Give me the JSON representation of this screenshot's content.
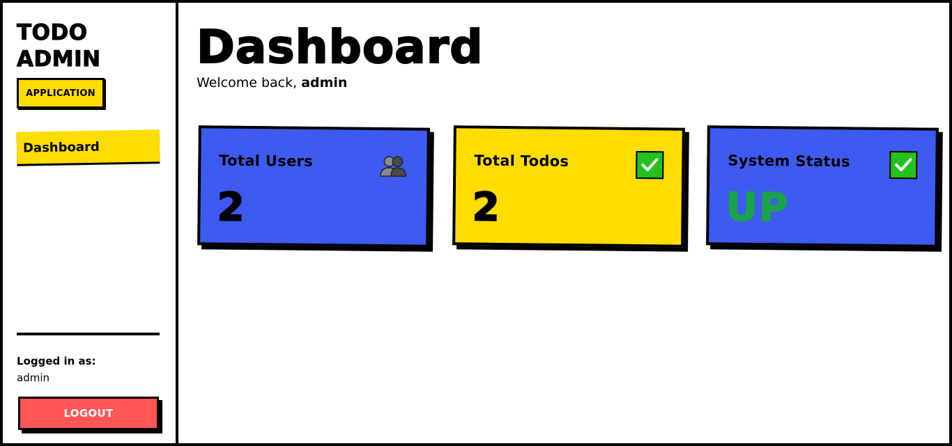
{
  "sidebar": {
    "brand_line1": "TODO",
    "brand_line2": "ADMIN",
    "badge": "APPLICATION",
    "nav": [
      {
        "label": "Dashboard",
        "active": true
      }
    ],
    "logged_in_label": "Logged in as:",
    "logged_in_user": "admin",
    "logout_label": "LOGOUT"
  },
  "main": {
    "title": "Dashboard",
    "welcome_prefix": "Welcome back, ",
    "welcome_user": "admin",
    "cards": [
      {
        "title": "Total Users",
        "value": "2",
        "icon": "users-icon",
        "color": "#3d5af1"
      },
      {
        "title": "Total Todos",
        "value": "2",
        "icon": "check-icon",
        "color": "#ffdd00"
      },
      {
        "title": "System Status",
        "value": "UP",
        "icon": "check-icon",
        "color": "#3d5af1",
        "value_color": "#1aa34a"
      }
    ]
  },
  "colors": {
    "accent_yellow": "#ffdd00",
    "accent_blue": "#3d5af1",
    "logout_red": "#ff5555",
    "status_green": "#1aa34a",
    "check_green": "#23c21e"
  }
}
